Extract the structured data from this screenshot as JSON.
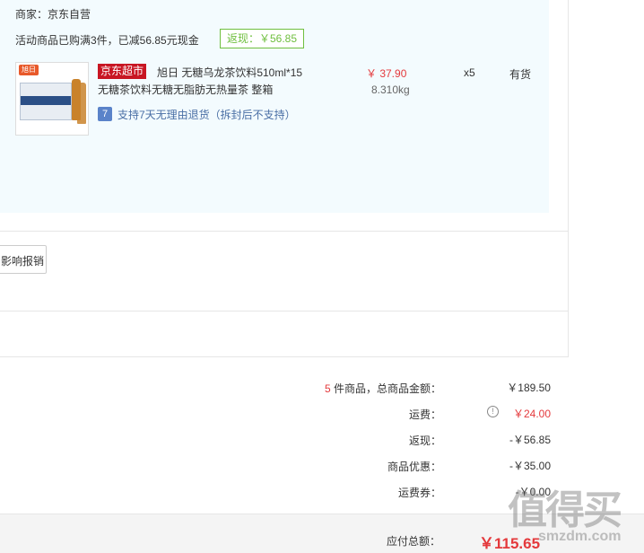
{
  "shop": {
    "merchant": "商家：京东自营",
    "promo_text": "活动商品已购满3件，已减56.85元现金",
    "rebate_badge": "返现：￥56.85"
  },
  "item": {
    "thumb_tag": "旭日",
    "store_badge": "京东超市",
    "title_line1": "旭日 无糖乌龙茶饮料510ml*15",
    "title_line2": "无糖茶饮料无糖无脂肪无热量茶 整箱",
    "return_icon": "7",
    "return_text": "支持7天无理由退货（拆封后不支持）",
    "price": "￥ 37.90",
    "weight": "8.310kg",
    "qty": "x5",
    "stock": "有货"
  },
  "invoice": {
    "button_label": "影响报销"
  },
  "summary": {
    "count": "5",
    "count_label": "件商品，总商品金额：",
    "goods_total": "￥189.50",
    "shipping_label": "运费：",
    "shipping_value": "￥24.00",
    "cashback_label": "返现：",
    "cashback_value": "-￥56.85",
    "discount_label": "商品优惠：",
    "discount_value": "-￥35.00",
    "coupon_label": "运费券：",
    "coupon_value": "-￥0.00"
  },
  "total": {
    "label": "应付总额：",
    "value": "￥115.65"
  },
  "watermark": {
    "text": "值得买",
    "url": "smzdm.com"
  },
  "colors": {
    "accent": "#e4393c",
    "panel": "#f3fbfe",
    "green": "#6fbf3f"
  }
}
